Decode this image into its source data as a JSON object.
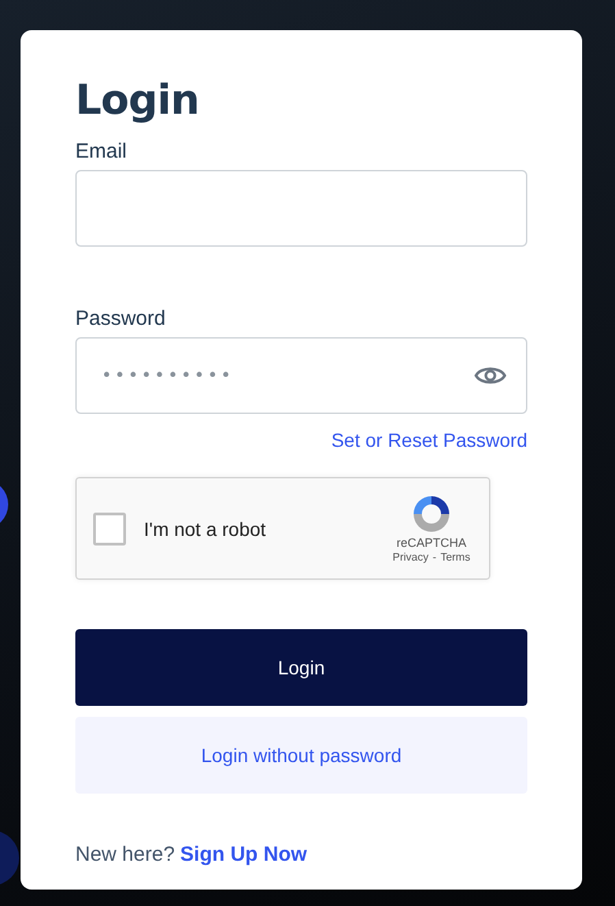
{
  "title": "Login",
  "fields": [
    {
      "label": "Email",
      "kind": "email"
    },
    {
      "label": "Password",
      "value": "••••••••••",
      "kind": "password"
    }
  ],
  "reset_link": "Set or Reset Password",
  "captcha": {
    "label": "I'm not a robot",
    "checked": false,
    "brand": "reCAPTCHA",
    "privacy": "Privacy",
    "separator": "-",
    "terms": "Terms"
  },
  "buttons": [
    {
      "label": "Login",
      "kind": "primary"
    },
    {
      "label": "Login without password",
      "kind": "secondary"
    }
  ],
  "footer": {
    "text": "New here?",
    "link": "Sign Up Now"
  }
}
